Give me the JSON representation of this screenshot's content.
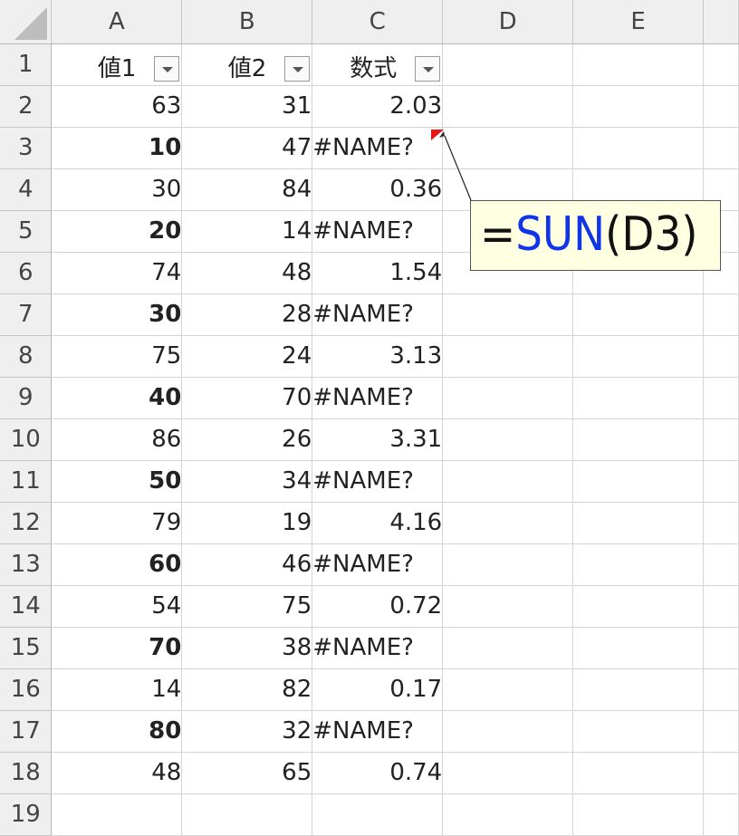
{
  "columns": [
    "A",
    "B",
    "C",
    "D",
    "E"
  ],
  "headers": {
    "row": "1",
    "a": "値1",
    "b": "値2",
    "c": "数式"
  },
  "rows": [
    {
      "row": "2",
      "a": "63",
      "b": "31",
      "c": "2.03"
    },
    {
      "row": "3",
      "a": "10",
      "b": "47",
      "c": "#NAME?"
    },
    {
      "row": "4",
      "a": "30",
      "b": "84",
      "c": "0.36"
    },
    {
      "row": "5",
      "a": "20",
      "b": "14",
      "c": "#NAME?"
    },
    {
      "row": "6",
      "a": "74",
      "b": "48",
      "c": "1.54"
    },
    {
      "row": "7",
      "a": "30",
      "b": "28",
      "c": "#NAME?"
    },
    {
      "row": "8",
      "a": "75",
      "b": "24",
      "c": "3.13"
    },
    {
      "row": "9",
      "a": "40",
      "b": "70",
      "c": "#NAME?"
    },
    {
      "row": "10",
      "a": "86",
      "b": "26",
      "c": "3.31"
    },
    {
      "row": "11",
      "a": "50",
      "b": "34",
      "c": "#NAME?"
    },
    {
      "row": "12",
      "a": "79",
      "b": "19",
      "c": "4.16"
    },
    {
      "row": "13",
      "a": "60",
      "b": "46",
      "c": "#NAME?"
    },
    {
      "row": "14",
      "a": "54",
      "b": "75",
      "c": "0.72"
    },
    {
      "row": "15",
      "a": "70",
      "b": "38",
      "c": "#NAME?"
    },
    {
      "row": "16",
      "a": "14",
      "b": "82",
      "c": "0.17"
    },
    {
      "row": "17",
      "a": "80",
      "b": "32",
      "c": "#NAME?"
    },
    {
      "row": "18",
      "a": "48",
      "b": "65",
      "c": "0.74"
    },
    {
      "row": "19",
      "a": "",
      "b": "",
      "c": ""
    }
  ],
  "comment": {
    "eq": "=",
    "fn": "SUN",
    "args": "(D3)"
  },
  "icons": [
    "filter-dropdown-icon",
    "select-all-icon",
    "comment-indicator-icon"
  ],
  "colors": {
    "comment_bg": "#ffffe1",
    "function_name": "#1034e8",
    "comment_indicator": "#e81515"
  }
}
